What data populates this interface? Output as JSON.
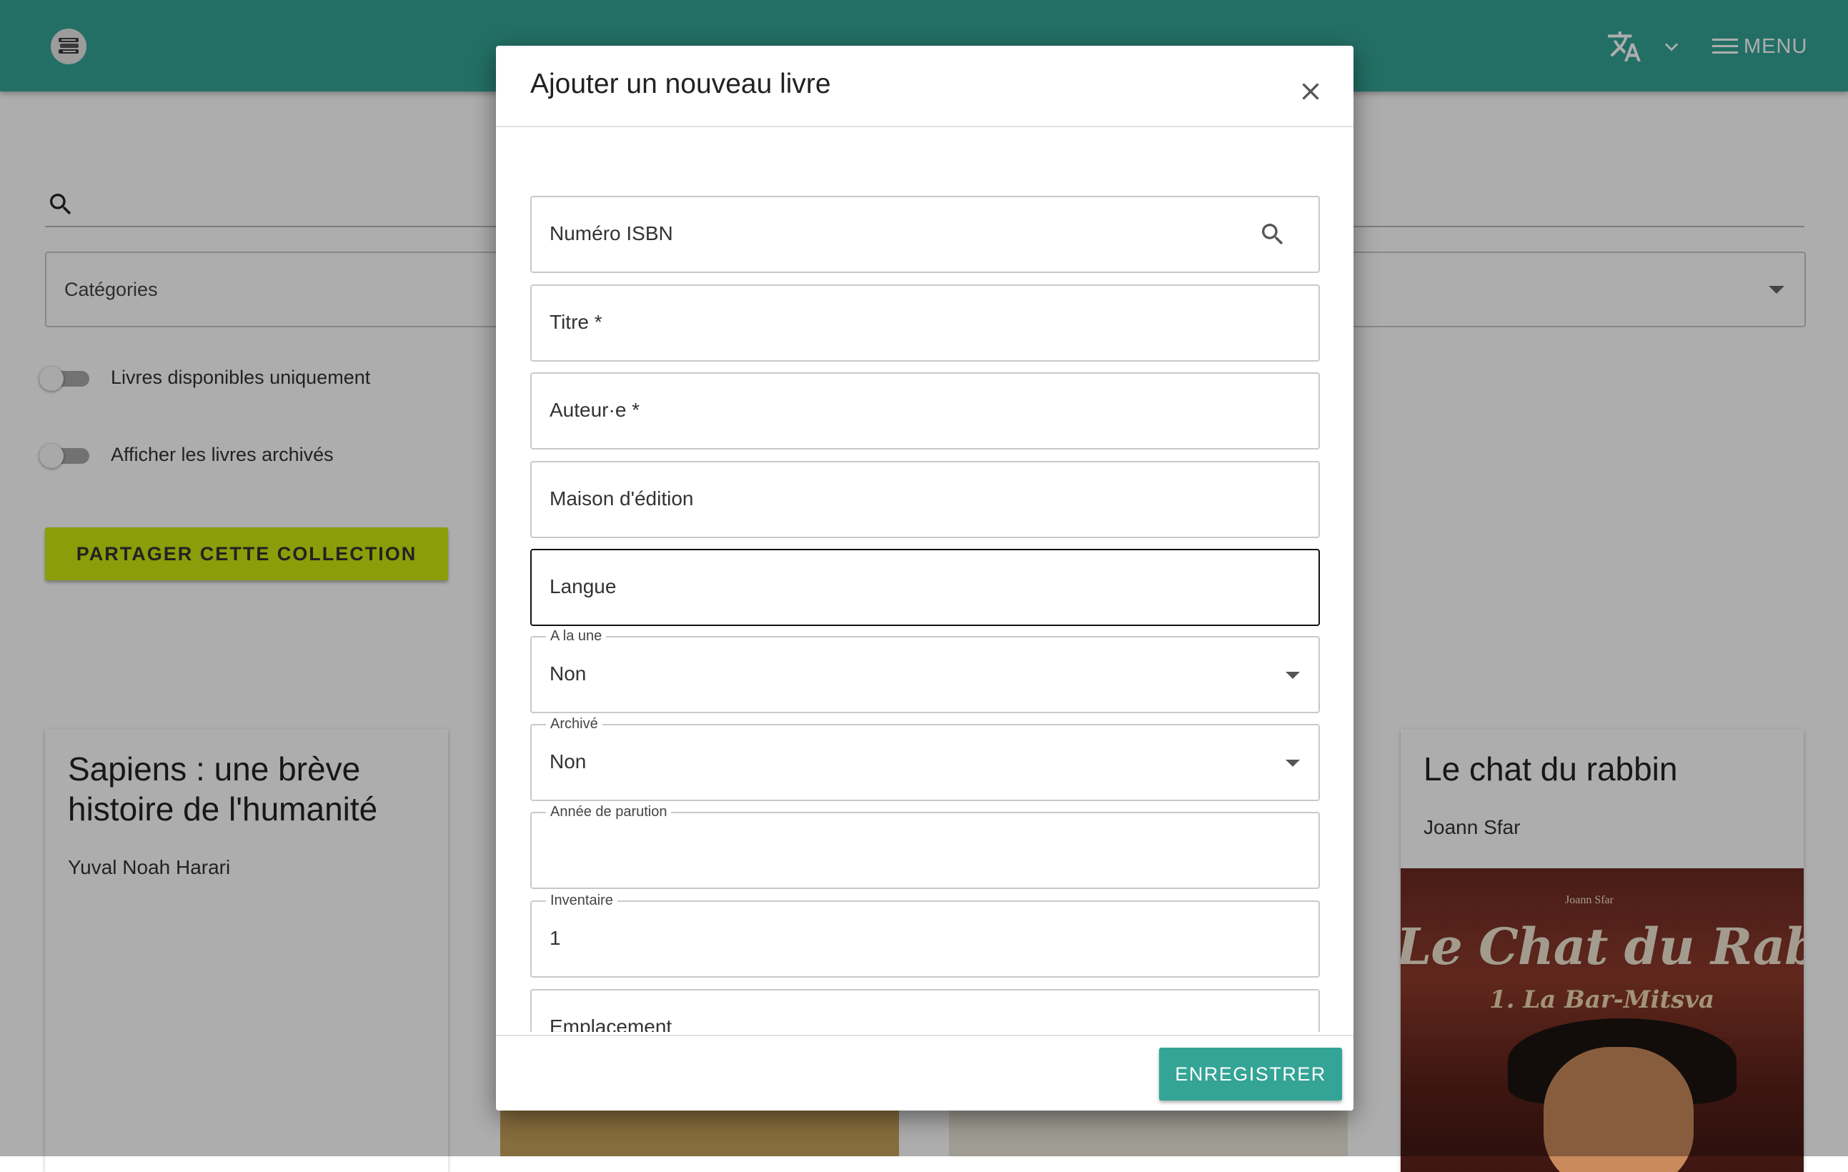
{
  "header": {
    "logo_icon": "stacked-books-icon",
    "language_icon": "translate-icon",
    "menu_label": "MENU",
    "background_color": "#34a496"
  },
  "filters": {
    "search_icon": "search-icon",
    "categories_label": "Catégories",
    "available_only_label": "Livres disponibles uniquement",
    "show_archived_label": "Afficher les livres archivés",
    "share_button_label": "PARTAGER CETTE COLLECTION",
    "share_button_color": "#cde80e"
  },
  "books": [
    {
      "title": "Sapiens : une brève histoire de l'humanité",
      "author": "Yuval Noah Harari"
    },
    {
      "title": "Le chat du rabbin",
      "author": "Joann Sfar",
      "cover": {
        "author": "Joann Sfar",
        "title": "Le Chat du Rabbin",
        "subtitle": "1. La Bar-Mitsva"
      }
    }
  ],
  "dialog": {
    "title": "Ajouter un nouveau livre",
    "fields": {
      "isbn": {
        "placeholder": "Numéro ISBN"
      },
      "titre": {
        "placeholder": "Titre *"
      },
      "auteur": {
        "placeholder": "Auteur·e *"
      },
      "maison": {
        "placeholder": "Maison d'édition"
      },
      "langue": {
        "placeholder": "Langue"
      },
      "a_la_une": {
        "label": "A la une",
        "value": "Non"
      },
      "archive": {
        "label": "Archivé",
        "value": "Non"
      },
      "annee": {
        "label": "Année de parution",
        "value": ""
      },
      "inventaire": {
        "label": "Inventaire",
        "value": "1"
      },
      "emplacement": {
        "placeholder": "Emplacement"
      }
    },
    "save_label": "ENREGISTRER",
    "save_color": "#34a496"
  }
}
